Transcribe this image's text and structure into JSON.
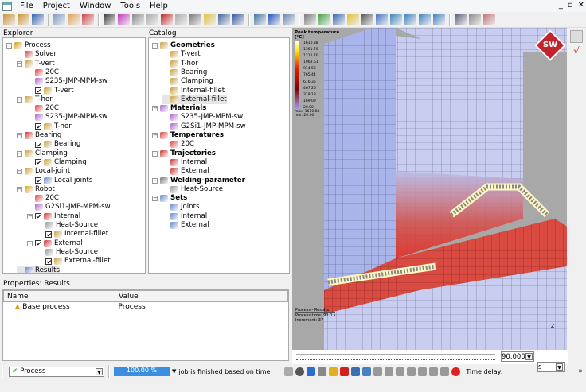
{
  "menu": {
    "items": [
      "File",
      "Project",
      "Window",
      "Tools",
      "Help"
    ]
  },
  "window_controls": [
    "_",
    "▫",
    "✕"
  ],
  "toolbar_icons": [
    "open-folder-icon",
    "save-all-icon",
    "save-icon",
    "image-icon",
    "page-icon",
    "layout-icon",
    "axes-icon",
    "color-scale-icon",
    "mesh-lines-icon",
    "node-numbers-icon",
    "probe-icon",
    "chart-icon",
    "cut-icon",
    "ruler-icon",
    "screenshot-icon",
    "scissors-icon",
    "import-icon",
    "export-icon",
    "copy-icon",
    "view-front-icon",
    "color-map-icon",
    "deformation-icon",
    "lighting-icon",
    "move-icon",
    "zoom-icon",
    "view-iso-icon",
    "view-top-icon",
    "view-side-icon",
    "view-back-icon",
    "rotate-icon",
    "frame-icon",
    "material-icon"
  ],
  "explorer": {
    "title": "Explorer",
    "items": [
      {
        "label": "Process",
        "level": 0,
        "icon": "process-icon",
        "color": "#d9a020"
      },
      {
        "label": "Solver",
        "level": 1,
        "icon": "solver-icon",
        "color": "#c44"
      },
      {
        "label": "T-vert",
        "level": 1,
        "icon": "part-icon",
        "color": "#c8a040",
        "exp": true
      },
      {
        "label": "20C",
        "level": 2,
        "icon": "temperature-icon",
        "color": "#d44"
      },
      {
        "label": "S235-JMP-MPM-sw",
        "level": 2,
        "icon": "material-icon",
        "color": "#a6c"
      },
      {
        "label": "T-vert",
        "level": 2,
        "icon": "geometry-icon",
        "color": "#c8a040",
        "check": true
      },
      {
        "label": "T-hor",
        "level": 1,
        "icon": "part-icon",
        "color": "#c8a040",
        "exp": true
      },
      {
        "label": "20C",
        "level": 2,
        "icon": "temperature-icon",
        "color": "#d44"
      },
      {
        "label": "S235-JMP-MPM-sw",
        "level": 2,
        "icon": "material-icon",
        "color": "#a6c"
      },
      {
        "label": "T-hor",
        "level": 2,
        "icon": "geometry-icon",
        "color": "#c8a040",
        "check": true
      },
      {
        "label": "Bearing",
        "level": 1,
        "icon": "bearing-icon",
        "color": "#c33",
        "exp": true
      },
      {
        "label": "Bearing",
        "level": 2,
        "icon": "geometry-icon",
        "color": "#c8a040",
        "check": true
      },
      {
        "label": "Clamping",
        "level": 1,
        "icon": "clamping-icon",
        "color": "#c8a040",
        "exp": true
      },
      {
        "label": "Clamping",
        "level": 2,
        "icon": "geometry-icon",
        "color": "#c8a040",
        "check": true
      },
      {
        "label": "Local-joint",
        "level": 1,
        "icon": "joint-icon",
        "color": "#c8a040",
        "exp": true
      },
      {
        "label": "Local joints",
        "level": 2,
        "icon": "sets-icon",
        "color": "#68c",
        "check": true
      },
      {
        "label": "Robot",
        "level": 1,
        "icon": "robot-icon",
        "color": "#d9a020",
        "exp": true
      },
      {
        "label": "20C",
        "level": 2,
        "icon": "temperature-icon",
        "color": "#d44"
      },
      {
        "label": "G2Si1-JMP-MPM-sw",
        "level": 2,
        "icon": "material-icon",
        "color": "#a6c"
      },
      {
        "label": "Internal",
        "level": 2,
        "icon": "trajectory-icon",
        "color": "#c33",
        "check": true,
        "exp": true
      },
      {
        "label": "Heat-Source",
        "level": 3,
        "icon": "welding-icon",
        "color": "#999"
      },
      {
        "label": "Internal-fillet",
        "level": 3,
        "icon": "geometry-icon",
        "color": "#c8a040",
        "check": true
      },
      {
        "label": "External",
        "level": 2,
        "icon": "trajectory-icon",
        "color": "#c33",
        "check": true,
        "exp": true
      },
      {
        "label": "Heat-Source",
        "level": 3,
        "icon": "welding-icon",
        "color": "#999"
      },
      {
        "label": "External-fillet",
        "level": 3,
        "icon": "geometry-icon",
        "color": "#c8a040",
        "check": true
      },
      {
        "label": "Results",
        "level": 1,
        "icon": "results-icon",
        "color": "#68c",
        "selected": true
      }
    ]
  },
  "catalog": {
    "title": "Catalog",
    "items": [
      {
        "label": "Geometries",
        "level": 0,
        "icon": "geometries-icon",
        "color": "#c8a040",
        "bold": true
      },
      {
        "label": "T-vert",
        "level": 1,
        "icon": "geometry-icon",
        "color": "#c8a040"
      },
      {
        "label": "T-hor",
        "level": 1,
        "icon": "geometry-icon",
        "color": "#c8a040"
      },
      {
        "label": "Bearing",
        "level": 1,
        "icon": "geometry-icon",
        "color": "#c8a040"
      },
      {
        "label": "Clamping",
        "level": 1,
        "icon": "geometry-icon",
        "color": "#c8a040"
      },
      {
        "label": "Internal-fillet",
        "level": 1,
        "icon": "geometry-icon",
        "color": "#c8a040"
      },
      {
        "label": "External-fillet",
        "level": 1,
        "icon": "geometry-icon",
        "color": "#c8a040",
        "selected": true
      },
      {
        "label": "Materials",
        "level": 0,
        "icon": "materials-icon",
        "color": "#a6c",
        "bold": true
      },
      {
        "label": "S235-JMP-MPM-sw",
        "level": 1,
        "icon": "material-icon",
        "color": "#a6c"
      },
      {
        "label": "G2Si1-JMP-MPM-sw",
        "level": 1,
        "icon": "material-icon",
        "color": "#a6c"
      },
      {
        "label": "Temperatures",
        "level": 0,
        "icon": "temperatures-icon",
        "color": "#d44",
        "bold": true
      },
      {
        "label": "20C",
        "level": 1,
        "icon": "temperature-icon",
        "color": "#d44"
      },
      {
        "label": "Trajectories",
        "level": 0,
        "icon": "trajectories-icon",
        "color": "#c33",
        "bold": true
      },
      {
        "label": "Internal",
        "level": 1,
        "icon": "trajectory-icon",
        "color": "#c33"
      },
      {
        "label": "External",
        "level": 1,
        "icon": "trajectory-icon",
        "color": "#c33"
      },
      {
        "label": "Welding-parameter",
        "level": 0,
        "icon": "welding-icon",
        "color": "#777",
        "bold": true
      },
      {
        "label": "Heat-Source",
        "level": 1,
        "icon": "welding-icon",
        "color": "#999"
      },
      {
        "label": "Sets",
        "level": 0,
        "icon": "sets-icon",
        "color": "#68c",
        "bold": true
      },
      {
        "label": "Joints",
        "level": 1,
        "icon": "set-icon",
        "color": "#68c"
      },
      {
        "label": "Internal",
        "level": 1,
        "icon": "set-icon",
        "color": "#68c"
      },
      {
        "label": "External",
        "level": 1,
        "icon": "set-icon",
        "color": "#68c"
      }
    ]
  },
  "properties": {
    "title": "Properties: Results",
    "columns": [
      "Name",
      "Value"
    ],
    "rows": [
      {
        "name": "Base process",
        "value": "Process"
      }
    ]
  },
  "viewport": {
    "legend": {
      "title": "Peak temperature [°C]",
      "values": [
        "1610.88",
        "1361.79",
        "1212.70",
        "1063.61",
        "914.53",
        "765.44",
        "616.35",
        "467.26",
        "318.18",
        "169.09",
        "20.00"
      ],
      "max": "max: 1610.88",
      "min": "min: 20.00"
    },
    "info": {
      "title": "Process - Results",
      "time": "Process time: 90.0 s",
      "increment": "Increment: 37"
    },
    "logo": "SW",
    "axis_labels": [
      "Z",
      "Y",
      "X"
    ]
  },
  "timeline": {
    "time_value": "90.000",
    "unit": "s",
    "position": 1.0
  },
  "status": {
    "process": "Process",
    "progress": "100.00 %",
    "progress_value": 100,
    "message": "job is finished based on time",
    "time_delay_label": "Time delay:",
    "more": "»"
  },
  "colors": {
    "mesh": "#a8b4e8",
    "hot": "#e02010",
    "progress": "#3a8fe0"
  }
}
